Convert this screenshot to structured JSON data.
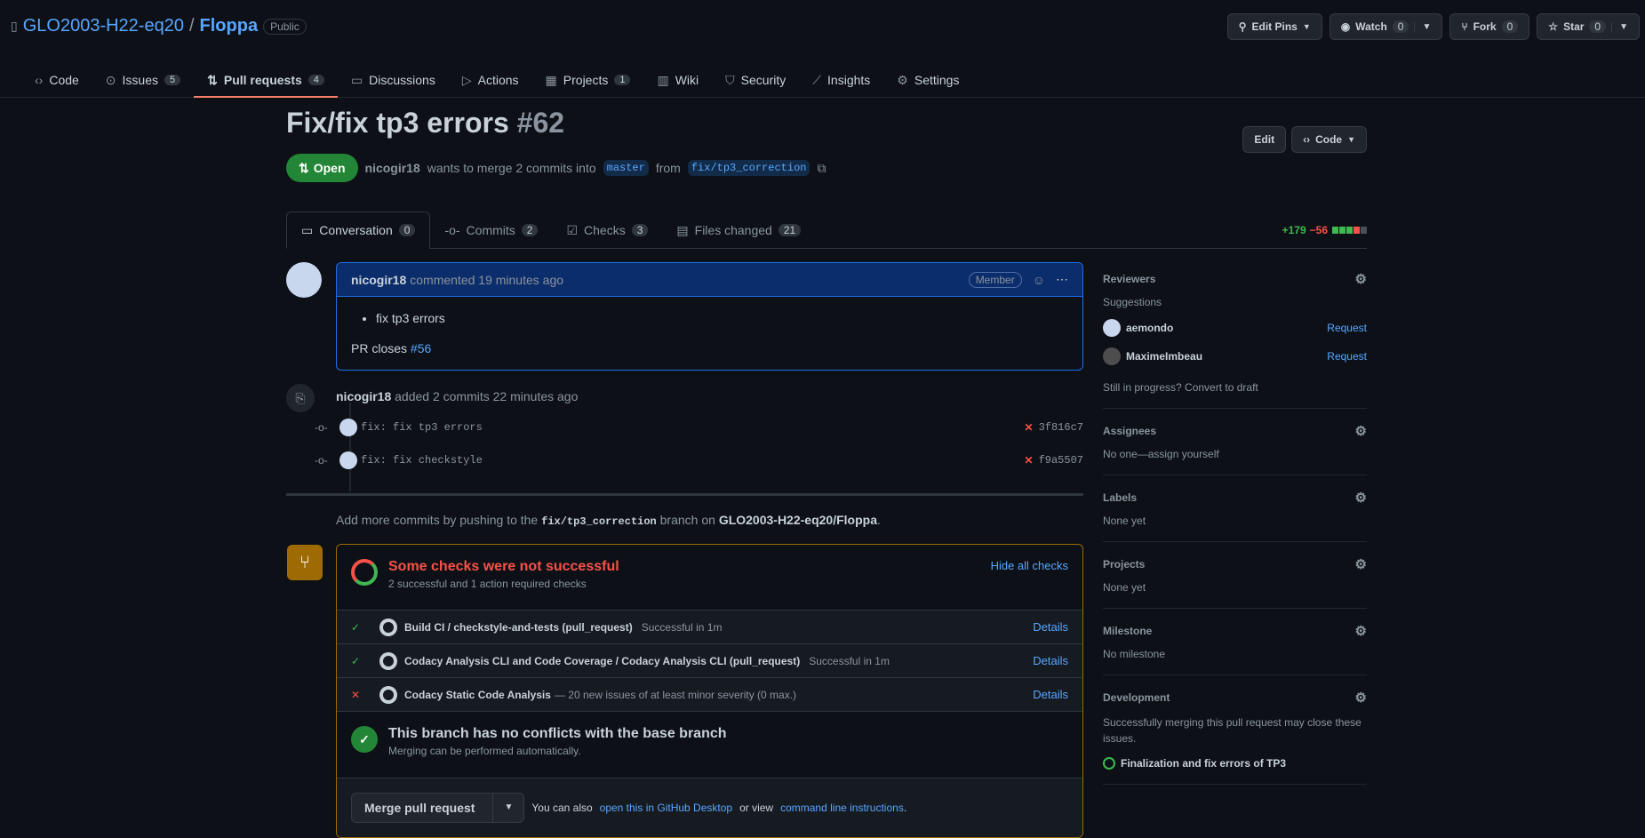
{
  "repo": {
    "owner": "GLO2003-H22-eq20",
    "name": "Floppa",
    "visibility": "Public"
  },
  "header_actions": {
    "edit_pins": "Edit Pins",
    "watch": "Watch",
    "watch_count": "0",
    "fork": "Fork",
    "fork_count": "0",
    "star": "Star",
    "star_count": "0"
  },
  "tabs": {
    "code": "Code",
    "issues": "Issues",
    "issues_count": "5",
    "pulls": "Pull requests",
    "pulls_count": "4",
    "discussions": "Discussions",
    "actions": "Actions",
    "projects": "Projects",
    "projects_count": "1",
    "wiki": "Wiki",
    "security": "Security",
    "insights": "Insights",
    "settings": "Settings"
  },
  "pr": {
    "title": "Fix/fix tp3 errors",
    "number": "#62",
    "state": "Open",
    "author": "nicogir18",
    "merge_text": "wants to merge 2 commits into",
    "base": "master",
    "from_text": "from",
    "head": "fix/tp3_correction",
    "edit": "Edit",
    "code": "Code"
  },
  "pr_tabs": {
    "conversation": "Conversation",
    "conversation_count": "0",
    "commits": "Commits",
    "commits_count": "2",
    "checks": "Checks",
    "checks_count": "3",
    "files": "Files changed",
    "files_count": "21"
  },
  "diffstat": {
    "additions": "+179",
    "deletions": "−56"
  },
  "comment": {
    "author": "nicogir18",
    "action": "commented 19 minutes ago",
    "badge": "Member",
    "bullet": "fix tp3 errors",
    "closes_text": "PR closes",
    "closes_link": "#56"
  },
  "commit_event": {
    "author": "nicogir18",
    "text": "added 2 commits 22 minutes ago",
    "commits": [
      {
        "message": "fix: fix tp3 errors",
        "sha": "3f816c7"
      },
      {
        "message": "fix: fix checkstyle",
        "sha": "f9a5507"
      }
    ]
  },
  "push_note": {
    "prefix": "Add more commits by pushing to the",
    "branch": "fix/tp3_correction",
    "mid": "branch on",
    "repo": "GLO2003-H22-eq20/Floppa",
    "suffix": "."
  },
  "mergebox": {
    "title": "Some checks were not successful",
    "subtitle": "2 successful and 1 action required checks",
    "hide": "Hide all checks",
    "checks": [
      {
        "name": "Build CI / checkstyle-and-tests (pull_request)",
        "desc": "Successful in 1m",
        "status": "✓",
        "details": "Details"
      },
      {
        "name": "Codacy Analysis CLI and Code Coverage / Codacy Analysis CLI (pull_request)",
        "desc": "Successful in 1m",
        "status": "✓",
        "details": "Details"
      },
      {
        "name": "Codacy Static Code Analysis",
        "desc": "— 20 new issues of at least minor severity (0 max.)",
        "status": "✕",
        "details": "Details"
      }
    ],
    "no_conflict_title": "This branch has no conflicts with the base branch",
    "no_conflict_sub": "Merging can be performed automatically.",
    "merge_button": "Merge pull request",
    "also_text": "You can also",
    "desktop_link": "open this in GitHub Desktop",
    "or_view": "or view",
    "cli_link": "command line instructions",
    "end": "."
  },
  "sidebar": {
    "reviewers": "Reviewers",
    "suggestions": "Suggestions",
    "reviewer_list": [
      {
        "name": "aemondo",
        "action": "Request"
      },
      {
        "name": "MaximeImbeau",
        "action": "Request"
      }
    ],
    "draft": "Still in progress? Convert to draft",
    "assignees": "Assignees",
    "assignees_value": "No one—assign yourself",
    "labels": "Labels",
    "labels_value": "None yet",
    "projects": "Projects",
    "projects_value": "None yet",
    "milestone": "Milestone",
    "milestone_value": "No milestone",
    "development": "Development",
    "development_text": "Successfully merging this pull request may close these issues.",
    "development_issue": "Finalization and fix errors of TP3"
  }
}
